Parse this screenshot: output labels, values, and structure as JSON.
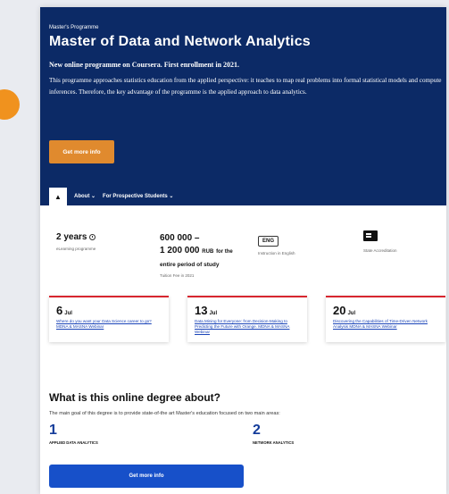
{
  "hero": {
    "eyebrow": "Master's Programme",
    "title": "Master of Data and Network Analytics",
    "subtitle": "New online programme on Coursera. First enrollment in 2021.",
    "description": "This programme approaches statistics education from the applied perspective: it teaches to map real problems into formal statistical models and compute inferences. Therefore, the key advantage of the programme is the applied approach to data analytics.",
    "cta_label": "Get more info"
  },
  "tabs": {
    "home_icon": "home-icon",
    "items": [
      "About ⌄",
      "For Prospective Students ⌄"
    ]
  },
  "facts": {
    "duration": {
      "value": "2 years",
      "label": "eLearning programme"
    },
    "price": {
      "line1": "600 000 –",
      "line2_amount": "1 200 000",
      "line2_currency": "RUB",
      "line2_rest": "for the",
      "line3": "entire period of study",
      "label": "Tuition Fee in 2021"
    },
    "language": {
      "badge": "ENG",
      "label": "Instruction in English"
    },
    "accreditation": {
      "label": "State Accreditation"
    }
  },
  "events": [
    {
      "day": "6",
      "month": "Jul",
      "title": "Where do you want your Data Science career to go? MDNA & MASNA Webinar"
    },
    {
      "day": "13",
      "month": "Jul",
      "title": "Data Mining for Everyone: from Decision-Making to Predicting the Future with Orange. MDNA & MASNA Webinar"
    },
    {
      "day": "20",
      "month": "Jul",
      "title": "Discovering the Capabilities of Time-Driven Network Analysis MDNA & MASNA Webinar"
    }
  ],
  "degree": {
    "title": "What is this online degree about?",
    "text": "The main goal of this degree is to provide state-of-the art Master's education focused on two main areas:",
    "areas": [
      {
        "num": "1",
        "label": "APPLIED DATA ANALYTICS"
      },
      {
        "num": "2",
        "label": "NETWORK ANALYTICS"
      }
    ],
    "cta_label": "Get more info"
  },
  "colors": {
    "hero_bg": "#0c2a66",
    "orange_cta": "#e08a2e",
    "blue_cta": "#1750c9",
    "event_accent": "#d7262f"
  }
}
